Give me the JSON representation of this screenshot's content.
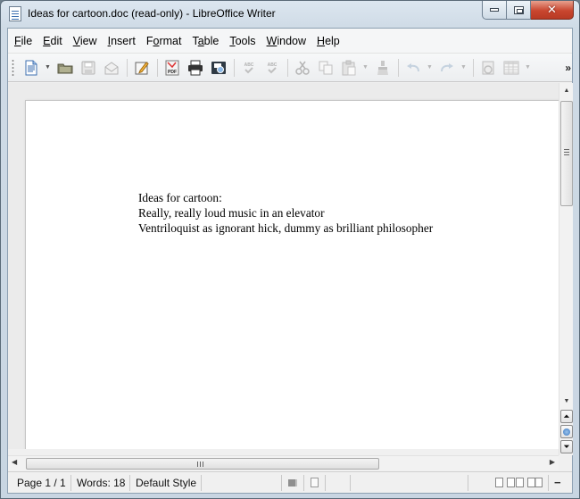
{
  "window": {
    "title": "Ideas for cartoon.doc (read-only) - LibreOffice Writer",
    "controls": {
      "minimize": "minimize-icon",
      "maximize": "maximize-icon",
      "close": "✕"
    }
  },
  "menubar": {
    "items": [
      {
        "label": "File",
        "accel": "F",
        "rest": "ile",
        "pre": ""
      },
      {
        "label": "Edit",
        "accel": "E",
        "rest": "dit",
        "pre": ""
      },
      {
        "label": "View",
        "accel": "V",
        "rest": "iew",
        "pre": ""
      },
      {
        "label": "Insert",
        "accel": "I",
        "rest": "nsert",
        "pre": ""
      },
      {
        "label": "Format",
        "accel": "o",
        "rest": "rmat",
        "pre": "F"
      },
      {
        "label": "Table",
        "accel": "a",
        "rest": "ble",
        "pre": "T"
      },
      {
        "label": "Tools",
        "accel": "T",
        "rest": "ools",
        "pre": ""
      },
      {
        "label": "Window",
        "accel": "W",
        "rest": "indow",
        "pre": ""
      },
      {
        "label": "Help",
        "accel": "H",
        "rest": "elp",
        "pre": ""
      }
    ]
  },
  "toolbar": {
    "buttons": [
      {
        "name": "new-document",
        "enabled": true
      },
      {
        "name": "open",
        "enabled": true
      },
      {
        "name": "save",
        "enabled": false
      },
      {
        "name": "email-document",
        "enabled": false
      },
      {
        "name": "edit-document",
        "enabled": true
      },
      {
        "name": "export-pdf",
        "enabled": true,
        "label": "PDF"
      },
      {
        "name": "print",
        "enabled": true
      },
      {
        "name": "print-preview",
        "enabled": true
      },
      {
        "name": "spellcheck",
        "enabled": false,
        "label": "ABC"
      },
      {
        "name": "autospellcheck",
        "enabled": false,
        "label": "ABC"
      },
      {
        "name": "cut",
        "enabled": false
      },
      {
        "name": "copy",
        "enabled": false
      },
      {
        "name": "paste",
        "enabled": false
      },
      {
        "name": "clone-formatting",
        "enabled": false
      },
      {
        "name": "undo",
        "enabled": false
      },
      {
        "name": "redo",
        "enabled": false
      },
      {
        "name": "navigator",
        "enabled": false
      },
      {
        "name": "table",
        "enabled": false
      }
    ],
    "overflow_label": "»"
  },
  "document": {
    "lines": [
      "Ideas for cartoon:",
      "Really, really loud music in an elevator",
      "Ventriloquist as ignorant hick, dummy as brilliant philosopher"
    ]
  },
  "scrollbars": {
    "up": "▲",
    "down": "▼",
    "left": "◀",
    "right": "▶",
    "prev_page": "⏶",
    "next_page": "⏷"
  },
  "statusbar": {
    "page": "Page 1 / 1",
    "words": "Words: 18",
    "style": "Default Style",
    "language": "",
    "zoom_out": "−"
  }
}
